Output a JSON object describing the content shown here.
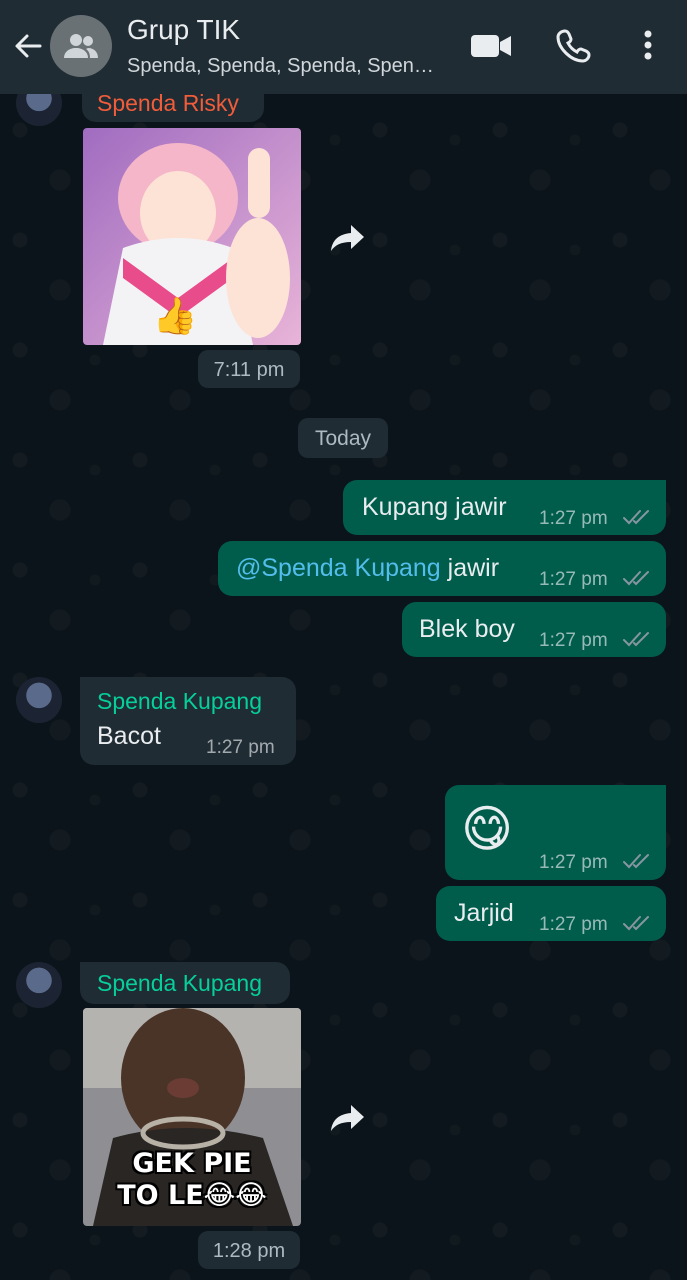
{
  "header": {
    "title": "Grup TIK",
    "subtitle": "Spenda, Spenda, Spenda, Spen…"
  },
  "date_divider": "Today",
  "messages": [
    {
      "sender": "Spenda Risky",
      "sender_color": "#f15c3a",
      "type": "sticker",
      "time": "7:11 pm"
    },
    {
      "type": "text",
      "direction": "out",
      "text": "Kupang jawir",
      "time": "1:27 pm"
    },
    {
      "type": "text",
      "direction": "out",
      "mention": "@Spenda Kupang",
      "text": " jawir",
      "time": "1:27 pm"
    },
    {
      "type": "text",
      "direction": "out",
      "text": "Blek boy",
      "time": "1:27 pm"
    },
    {
      "sender": "Spenda Kupang",
      "sender_color": "#06cf9c",
      "type": "text",
      "direction": "in",
      "text": "Bacot",
      "time": "1:27 pm"
    },
    {
      "type": "emoji",
      "direction": "out",
      "text": "😋",
      "time": "1:27 pm"
    },
    {
      "type": "text",
      "direction": "out",
      "text": "Jarjid",
      "time": "1:27 pm"
    },
    {
      "sender": "Spenda Kupang",
      "sender_color": "#06cf9c",
      "type": "sticker",
      "caption_line1": "GEK PIE",
      "caption_line2": "TO LE😂😂",
      "time": "1:28 pm"
    }
  ],
  "colors": {
    "header_bg": "#1f2c34",
    "outgoing_bubble": "#005c4b",
    "incoming_bubble": "#1f2c34",
    "mention": "#53bdeb"
  }
}
